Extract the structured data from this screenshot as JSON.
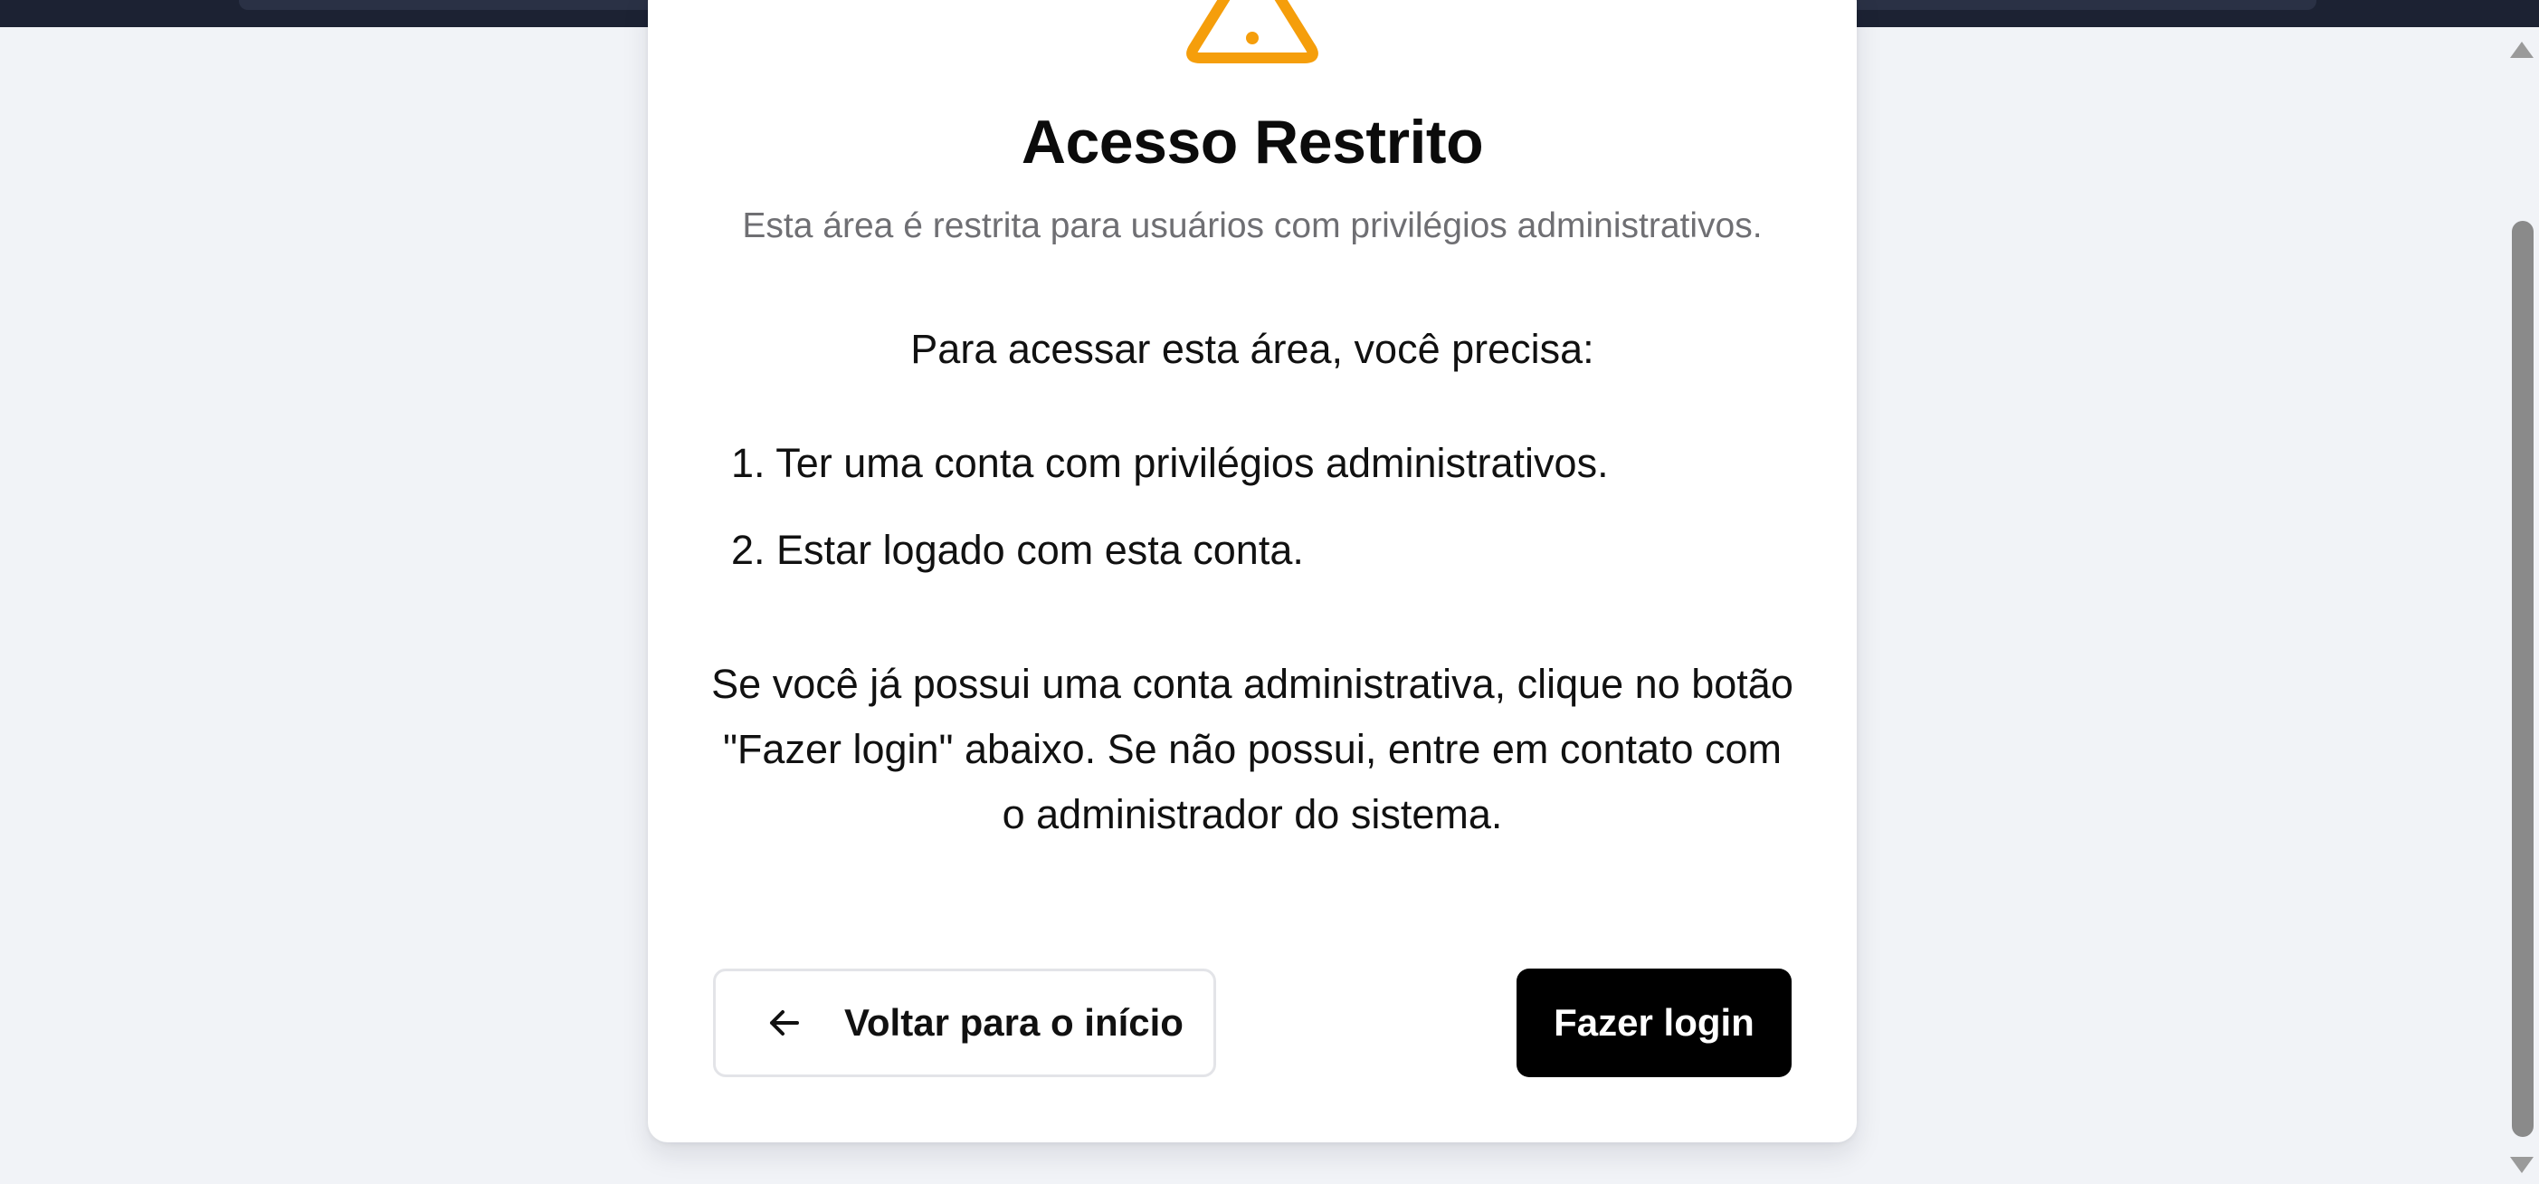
{
  "page": {
    "title": "Acesso Restrito",
    "subtitle": "Esta área é restrita para usuários com privilégios administrativos.",
    "intro": "Para acessar esta área, você precisa:",
    "requirements": [
      "1. Ter uma conta com privilégios administrativos.",
      "2. Estar logado com esta conta."
    ],
    "help_text": "Se você já possui uma conta administrativa, clique no botão \"Fazer login\" abaixo. Se não possui, entre em contato com o administrador do sistema."
  },
  "actions": {
    "back_label": "Voltar para o início",
    "back_icon": "arrow-left-icon",
    "login_label": "Fazer login"
  },
  "icons": {
    "header_icon": "warning-icon"
  },
  "colors": {
    "warning": "#F59E0B",
    "primary_button": "#000000",
    "background": "#F1F3F7",
    "muted_text": "#6F6F73"
  }
}
